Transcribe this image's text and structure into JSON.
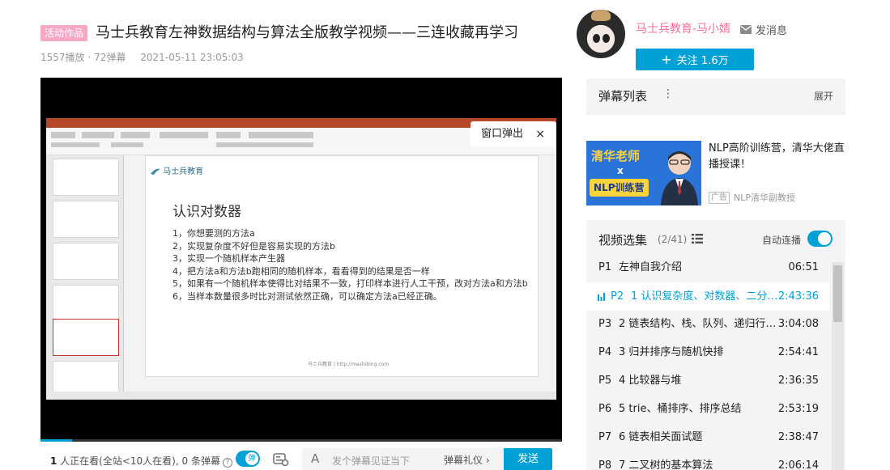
{
  "video": {
    "tag": "活动作品",
    "title": "马士兵教育左神数据结构与算法全版教学视频——三连收藏再学习",
    "plays": "1557播放",
    "danmaku_count": "· 72弹幕",
    "date": "2021-05-11 23:05:03"
  },
  "uploader": {
    "name": "马士兵教育-马小婧",
    "message_label": "发消息",
    "follow_label": "关注 1.6万"
  },
  "slide": {
    "logo": "马士兵教育",
    "title": "认识对数器",
    "items": [
      "1，你想要测的方法a",
      "2，实现复杂度不好但是容易实现的方法b",
      "3，实现一个随机样本产生器",
      "4，把方法a和方法b跑相同的随机样本，看看得到的结果是否一样",
      "5，如果有一个随机样本使得比对结果不一致，打印样本进行人工干预，改对方法a和方法b",
      "6，当样本数量很多时比对测试依然正确，可以确定方法a已经正确。"
    ],
    "footer": "马士兵教育 | http://mashibing.com"
  },
  "popup": {
    "label": "窗口弹出",
    "close": "×"
  },
  "danmaku_bar": {
    "watching_count": "1",
    "watching_text": " 人正在看(全站<10人在看), 0 条弹幕",
    "toggle_label": "弹",
    "input_placeholder": "发个弹幕见证当下",
    "etiquette": "弹幕礼仪 ›",
    "send": "发送"
  },
  "danmaku_list": {
    "title": "弹幕列表",
    "more": "⋮",
    "expand": "展开"
  },
  "ad": {
    "line1": "清华老师",
    "line2": "x",
    "line3": "NLP训练营",
    "title": "NLP高阶训练营，清华大佬直播授课！",
    "badge": "广告",
    "source": "NLP清华副教授"
  },
  "playlist": {
    "title": "视频选集",
    "count": "(2/41)",
    "autoplay": "自动连播",
    "episodes": [
      {
        "p": "P1",
        "name": "左神自我介绍",
        "dur": "06:51"
      },
      {
        "p": "P2",
        "name": "1 认识复杂度、对数器、二分法与...",
        "dur": "2:43:36"
      },
      {
        "p": "P3",
        "name": "2 链表结构、栈、队列、递归行为、...",
        "dur": "3:04:08"
      },
      {
        "p": "P4",
        "name": "3 归并排序与随机快排",
        "dur": "2:54:41"
      },
      {
        "p": "P5",
        "name": "4 比较器与堆",
        "dur": "2:36:35"
      },
      {
        "p": "P6",
        "name": "5 trie、桶排序、排序总结",
        "dur": "2:53:19"
      },
      {
        "p": "P7",
        "name": "6 链表相关面试题",
        "dur": "2:38:47"
      },
      {
        "p": "P8",
        "name": "7 二叉树的基本算法",
        "dur": "2:06:14"
      }
    ]
  },
  "colors": {
    "accent": "#00a1d6",
    "pink": "#fb7299",
    "tag": "#f7a8c4"
  }
}
